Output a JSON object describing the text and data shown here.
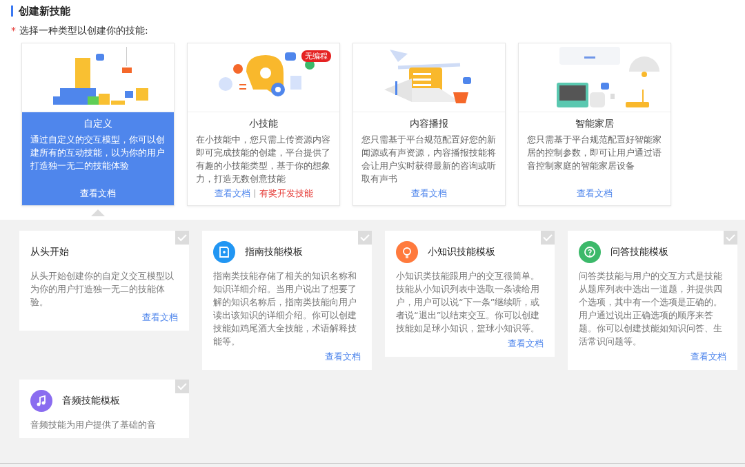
{
  "title": "创建新技能",
  "prompt": {
    "required_mark": "*",
    "text": "选择一种类型以创建你的技能:"
  },
  "types": [
    {
      "kind": "custom",
      "title": "自定义",
      "selected": true,
      "description": "通过自定义的交互模型，你可以创建所有的互动技能，以为你的用户打造独一无二的技能体验",
      "links": [
        {
          "kind": "doc",
          "text": "查看文档"
        }
      ]
    },
    {
      "kind": "small",
      "title": "小技能",
      "selected": false,
      "badge": "无编程",
      "description": "在小技能中，您只需上传资源内容即可完成技能的创建，平台提供了有趣的小技能类型，基于你的想象力，打造无数创意技能",
      "links": [
        {
          "kind": "doc",
          "text": "查看文档"
        },
        {
          "kind": "reward",
          "text": "有奖开发技能"
        }
      ]
    },
    {
      "kind": "content",
      "title": "内容播报",
      "selected": false,
      "description": "您只需基于平台规范配置好您的新闻源或有声资源，内容播报技能将会让用户实时获得最新的咨询或听取有声书",
      "links": [
        {
          "kind": "doc",
          "text": "查看文档"
        }
      ]
    },
    {
      "kind": "home",
      "title": "智能家居",
      "selected": false,
      "description": "您只需基于平台规范配置好智能家居的控制参数，即可让用户通过语音控制家庭的智能家居设备",
      "links": [
        {
          "kind": "doc",
          "text": "查看文档"
        }
      ]
    }
  ],
  "templates": [
    {
      "kind": "blank",
      "title": "从头开始",
      "checked": false,
      "description": "从头开始创建你的自定义交互模型以为你的用户打造独一无二的技能体验。",
      "link": "查看文档"
    },
    {
      "kind": "guide",
      "color": "#2196f3",
      "title": "指南技能模板",
      "checked": false,
      "description": "指南类技能存储了相关的知识名称和知识详细介绍。当用户说出了想要了解的知识名称后，指南类技能向用户读出该知识的详细介绍。你可以创建技能如鸡尾酒大全技能，术语解释技能等。",
      "link": "查看文档"
    },
    {
      "kind": "trivia",
      "color": "#ff7a3d",
      "title": "小知识技能模板",
      "checked": false,
      "description": "小知识类技能跟用户的交互很简单。技能从小知识列表中选取一条读给用户，用户可以说“下一条”继续听，或者说“退出”以结束交互。你可以创建技能如足球小知识，篮球小知识等。",
      "link": "查看文档"
    },
    {
      "kind": "qa",
      "color": "#3cb96a",
      "title": "问答技能模板",
      "checked": false,
      "description": "问答类技能与用户的交互方式是技能从题库列表中选出一道题，并提供四个选项，其中有一个选项是正确的。用户通过说出正确选项的顺序来答题。你可以创建技能如知识问答、生活常识问题等。",
      "link": "查看文档"
    },
    {
      "kind": "audio",
      "color": "#8a6cf0",
      "title": "音频技能模板",
      "checked": false,
      "description": "音频技能为用户提供了基础的音"
    }
  ]
}
